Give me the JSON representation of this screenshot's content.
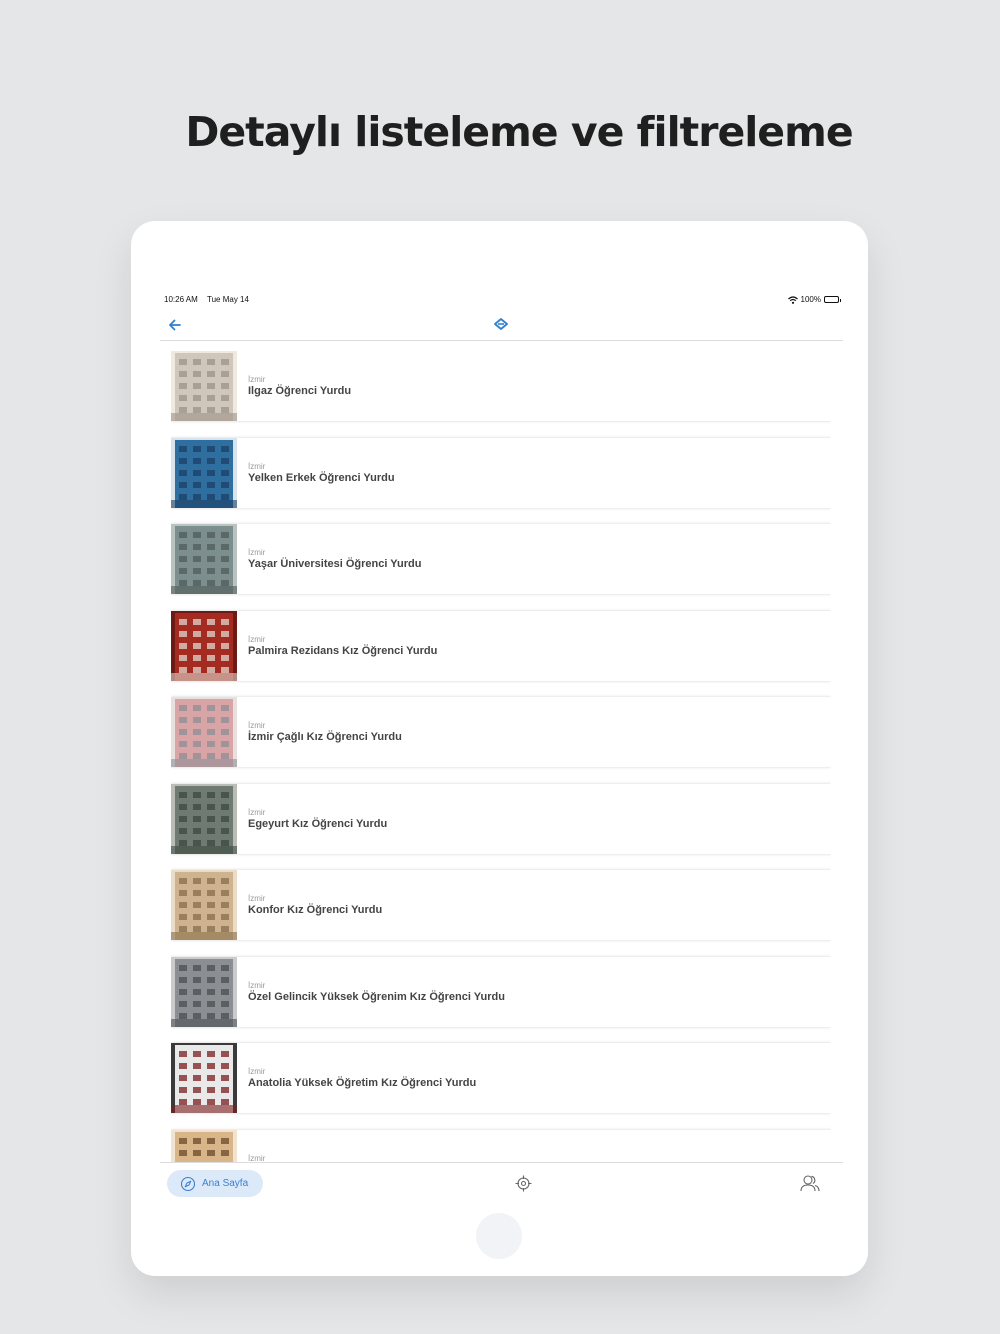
{
  "headline": "Detaylı listeleme ve filtreleme",
  "status_bar": {
    "time": "10:26 AM",
    "date": "Tue May 14",
    "battery": "100%"
  },
  "navbar": {
    "back_icon": "arrow-left-icon",
    "filter_icon": "filter-icon"
  },
  "items": [
    {
      "city": "İzmir",
      "name": "Ilgaz Öğrenci Yurdu",
      "photo": "building-photo"
    },
    {
      "city": "İzmir",
      "name": "Yelken Erkek Öğrenci Yurdu",
      "photo": "room-photo"
    },
    {
      "city": "İzmir",
      "name": "Yaşar Üniversitesi Öğrenci Yurdu",
      "photo": "building-photo"
    },
    {
      "city": "İzmir",
      "name": "Palmira Rezidans Kız Öğrenci Yurdu",
      "photo": "building-photo"
    },
    {
      "city": "İzmir",
      "name": "İzmir Çağlı Kız Öğrenci Yurdu",
      "photo": "building-photo"
    },
    {
      "city": "İzmir",
      "name": "Egeyurt Kız Öğrenci Yurdu",
      "photo": "building-photo"
    },
    {
      "city": "İzmir",
      "name": "Konfor Kız Öğrenci Yurdu",
      "photo": "building-photo"
    },
    {
      "city": "İzmir",
      "name": "Özel Gelincik Yüksek Öğrenim Kız Öğrenci Yurdu",
      "photo": "building-photo"
    },
    {
      "city": "İzmir",
      "name": "Anatolia Yüksek Öğretim Kız Öğrenci Yurdu",
      "photo": "room-photo"
    },
    {
      "city": "İzmir",
      "name": "",
      "photo": "room-photo"
    }
  ],
  "tabbar": {
    "home_label": "Ana Sayfa",
    "home_icon": "compass-icon",
    "target_icon": "crosshair-icon",
    "users_icon": "users-icon"
  },
  "colors": {
    "accent": "#3b7fd0",
    "background": "#e5e6e7"
  }
}
